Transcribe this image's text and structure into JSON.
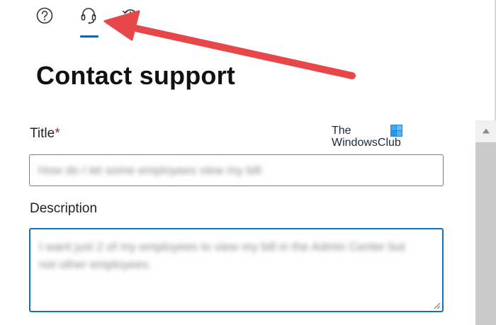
{
  "tabs": [
    {
      "name": "help",
      "icon": "help-circle-icon"
    },
    {
      "name": "contact-support",
      "icon": "headset-icon",
      "selected": true
    },
    {
      "name": "history",
      "icon": "history-icon"
    }
  ],
  "page": {
    "title": "Contact support"
  },
  "form": {
    "title_label": "Title",
    "required_marker": "*",
    "title_value": "How do I let some employees view my bill",
    "description_label": "Description",
    "description_value": "I want just 2 of my employees to view my bill in the Admin Center but not other employees."
  },
  "watermark": {
    "line1": "The",
    "line2": "WindowsClub"
  },
  "colors": {
    "accent": "#1464a8",
    "focus_border": "#1a6fb3",
    "required": "#a4262c",
    "annotation_arrow": "#e8474a"
  }
}
